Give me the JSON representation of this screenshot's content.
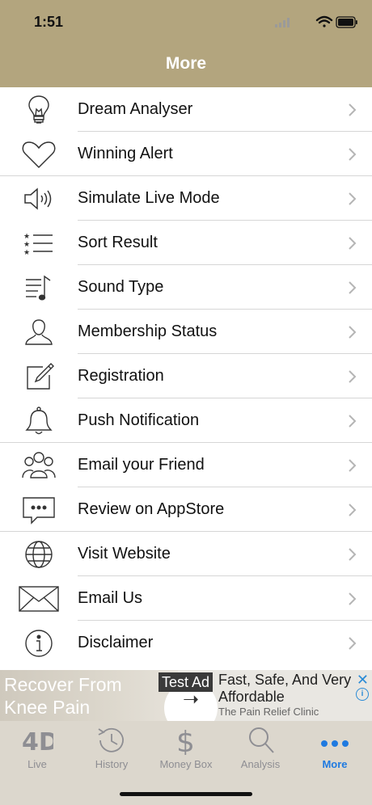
{
  "status_bar": {
    "time": "1:51"
  },
  "nav": {
    "title": "More"
  },
  "menu": [
    {
      "label": "Dream Analyser",
      "icon": "lightbulb-icon"
    },
    {
      "label": "Winning Alert",
      "icon": "heart-icon"
    },
    {
      "label": "Simulate Live Mode",
      "icon": "speaker-icon"
    },
    {
      "label": "Sort Result",
      "icon": "star-list-icon"
    },
    {
      "label": "Sound Type",
      "icon": "music-list-icon"
    },
    {
      "label": "Membership Status",
      "icon": "user-icon"
    },
    {
      "label": "Registration",
      "icon": "edit-icon"
    },
    {
      "label": "Push Notification",
      "icon": "bell-icon"
    },
    {
      "label": "Email your Friend",
      "icon": "group-icon"
    },
    {
      "label": "Review on AppStore",
      "icon": "chat-bubble-icon"
    },
    {
      "label": "Visit Website",
      "icon": "globe-icon"
    },
    {
      "label": "Email Us",
      "icon": "envelope-icon"
    },
    {
      "label": "Disclaimer",
      "icon": "info-icon"
    }
  ],
  "ad": {
    "headline": "Recover From Knee Pain",
    "badge": "Test Ad",
    "copy": "Fast, Safe, And Very Affordable",
    "advertiser": "The Pain Relief Clinic",
    "close": "✕",
    "info": "i"
  },
  "tabbar": {
    "tabs": [
      {
        "label": "Live",
        "icon": "4d-icon",
        "active": false
      },
      {
        "label": "History",
        "icon": "history-icon",
        "active": false
      },
      {
        "label": "Money Box",
        "icon": "dollar-icon",
        "active": false
      },
      {
        "label": "Analysis",
        "icon": "magnifier-icon",
        "active": false
      },
      {
        "label": "More",
        "icon": "more-dots-icon",
        "active": true
      }
    ]
  },
  "colors": {
    "header": "#b3a57e",
    "active_tab": "#1f7ae0",
    "inactive_tab": "#8e8e93"
  }
}
